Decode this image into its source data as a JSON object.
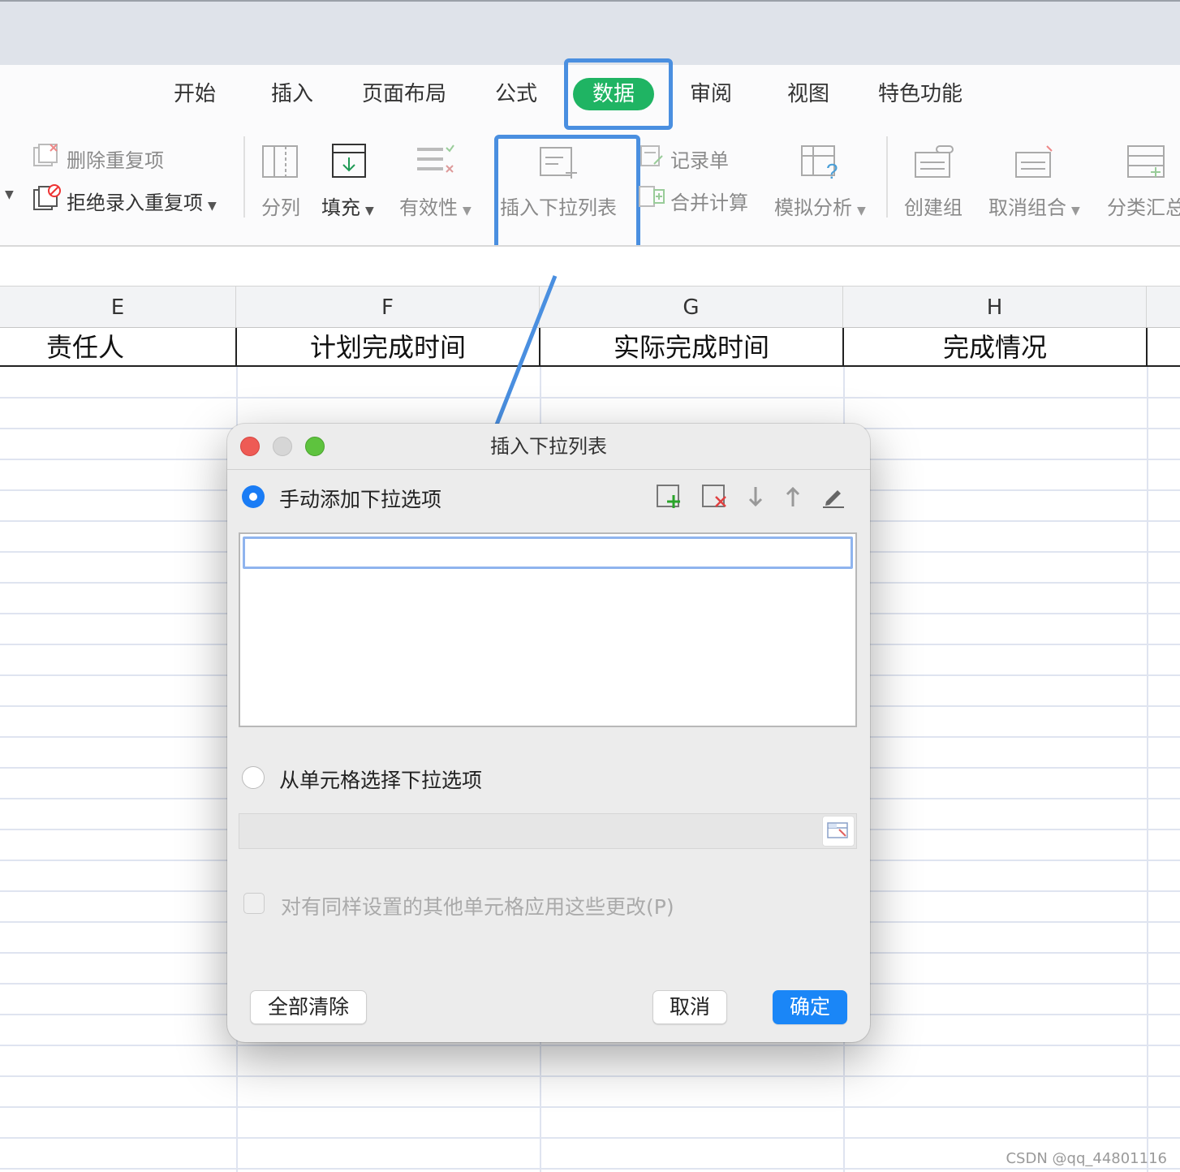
{
  "tabs": [
    "开始",
    "插入",
    "页面布局",
    "公式",
    "数据",
    "审阅",
    "视图",
    "特色功能"
  ],
  "active_tab": "数据",
  "toolbar": {
    "delete_dup": "删除重复项",
    "reject_dup": "拒绝录入重复项",
    "split": "分列",
    "fill": "填充",
    "validity": "有效性",
    "insert_dropdown": "插入下拉列表",
    "record_form": "记录单",
    "consolidate": "合并计算",
    "what_if": "模拟分析",
    "group": "创建组",
    "ungroup": "取消组合",
    "subtotal": "分类汇总"
  },
  "columns": [
    "E",
    "F",
    "G",
    "H"
  ],
  "headers": [
    "责任人",
    "计划完成时间",
    "实际完成时间",
    "完成情况"
  ],
  "dialog": {
    "title": "插入下拉列表",
    "manual_option": "手动添加下拉选项",
    "cell_option": "从单元格选择下拉选项",
    "apply_label": "对有同样设置的其他单元格应用这些更改(P)",
    "clear_all": "全部清除",
    "cancel": "取消",
    "ok": "确定"
  },
  "colors": {
    "accent": "#1a86f7",
    "active_tab": "#1fb463",
    "highlight": "#4a8fe0"
  },
  "watermark": "CSDN @qq_44801116"
}
